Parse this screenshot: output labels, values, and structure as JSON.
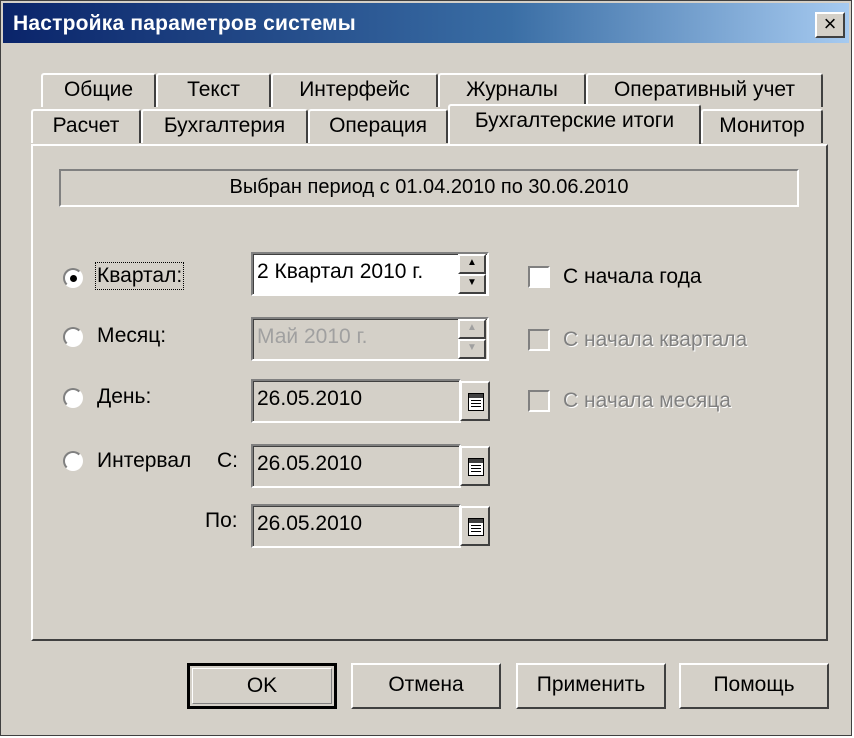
{
  "window": {
    "title": "Настройка параметров системы",
    "close_label": "×"
  },
  "tabs_row1": [
    "Общие",
    "Текст",
    "Интерфейс",
    "Журналы",
    "Оперативный учет"
  ],
  "tabs_row2": [
    "Расчет",
    "Бухгалтерия",
    "Операция",
    "Бухгалтерские итоги",
    "Монитор"
  ],
  "active_tab": "Бухгалтерские итоги",
  "period_text": "Выбран период с 01.04.2010 по 30.06.2010",
  "options": {
    "quarter": {
      "label": "Квартал:",
      "value": "2 Квартал 2010 г.",
      "selected": true
    },
    "month": {
      "label": "Месяц:",
      "value": "Май 2010 г.",
      "selected": false
    },
    "day": {
      "label": "День:",
      "value": "26.05.2010",
      "selected": false
    },
    "interval": {
      "label": "Интервал",
      "from_label": "С:",
      "from_value": "26.05.2010",
      "to_label": "По:",
      "to_value": "26.05.2010",
      "selected": false
    }
  },
  "checkboxes": {
    "year_start": {
      "label": "С начала года",
      "checked": false,
      "enabled": true
    },
    "quarter_start": {
      "label": "С начала квартала",
      "checked": false,
      "enabled": false
    },
    "month_start": {
      "label": "С начала месяца",
      "checked": false,
      "enabled": false
    }
  },
  "buttons": {
    "ok": "OK",
    "cancel": "Отмена",
    "apply": "Применить",
    "help": "Помощь"
  },
  "spin_up": "▲",
  "spin_down": "▼"
}
